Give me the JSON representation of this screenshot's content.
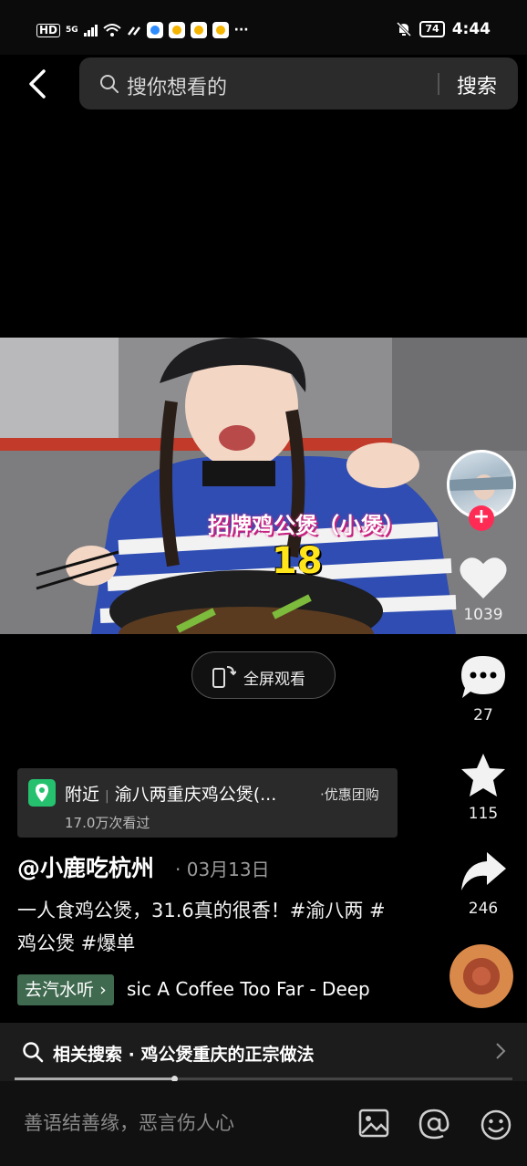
{
  "status_bar": {
    "network": "HD",
    "signal": "5G",
    "battery": "74",
    "time": "4:44",
    "more": "···"
  },
  "search": {
    "placeholder": "搜你想看的",
    "button": "搜索"
  },
  "video": {
    "overlay_title": "招牌鸡公煲（小煲）",
    "overlay_price": "18"
  },
  "fullscreen": {
    "label": "全屏观看"
  },
  "rail": {
    "likes": "1039",
    "comments": "27",
    "favorites": "115",
    "shares": "246"
  },
  "location": {
    "label": "附近",
    "name": "渝八两重庆鸡公煲(...",
    "tag": "·优惠团购",
    "views": "17.0万次看过"
  },
  "post": {
    "author": "@小鹿吃杭州",
    "date": "· 03月13日",
    "caption": "一人食鸡公煲，31.6真的很香！#渝八两 #鸡公煲 #爆单"
  },
  "music": {
    "button": "去汽水听",
    "track": "sic    A Coffee Too Far - Deep"
  },
  "related": {
    "text": "相关搜索 · 鸡公煲重庆的正宗做法"
  },
  "playback": {
    "progress": 0.32
  },
  "comment": {
    "placeholder": "善语结善缘，恶言伤人心"
  },
  "colors": {
    "accent_red": "#fe2c55",
    "location_green": "#25c16f",
    "music_green": "#3f6a4f",
    "price_yellow": "#ffe51a"
  },
  "icons": [
    "back-icon",
    "search-icon",
    "phone-rotate-icon",
    "heart-icon",
    "comment-icon",
    "star-icon",
    "share-icon",
    "location-pin-icon",
    "chevron-right-icon",
    "image-icon",
    "at-icon",
    "emoji-icon"
  ]
}
